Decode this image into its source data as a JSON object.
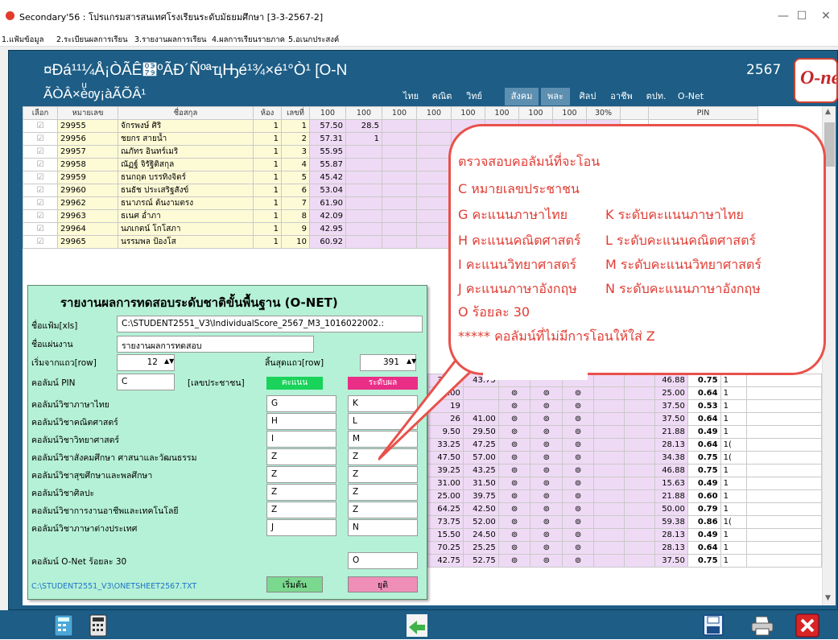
{
  "window": {
    "title": "Secondary'56 : โปรแกรมสารสนเทศโรงเรียนระดับมัธยมศึกษา [3-3-2567-2]",
    "minimize_glyph": "—",
    "maximize_glyph": "☐",
    "close_glyph": "✕"
  },
  "menu": [
    "1.แฟ้มข้อมูล",
    "2.ระเบียนผลการเรียน",
    "3.รายงานผลการเรียน",
    "4.ผลการเรียนรายภาค",
    "5.อเนกประสงค์"
  ],
  "header": {
    "title_line1": "¤Ðá¹¹¼Å¡ÒÃÊ͹ºÃÐ´ÑºªҵԢé¹¾×é¹°Ò¹ [O-N",
    "title_line2": "ÃÒÂ×èͧѹ¡àÃÕÂ¹",
    "year": "2567",
    "logo_text": "O-net",
    "subjects": [
      "ไทย",
      "คณิต",
      "วิทย์",
      "สังคม",
      "พละ",
      "ศิลป",
      "อาชีพ",
      "ตปท.",
      "O-Net"
    ]
  },
  "table": {
    "columns": [
      "เลือก",
      "หมายเลข",
      "ชื่อสกุล",
      "ห้อง",
      "เลขที่",
      "100",
      "100",
      "100",
      "100",
      "100",
      "100",
      "100",
      "100",
      "30%",
      "",
      "PIN"
    ],
    "top_rows": [
      {
        "check": "☑",
        "id": "29955",
        "name": "จักรพงษ์ ศิริ",
        "room": "1",
        "no": "1",
        "s1": "57.50",
        "s2": "28.5"
      },
      {
        "check": "☑",
        "id": "29956",
        "name": "ชยกร สายน้ำ",
        "room": "1",
        "no": "2",
        "s1": "57.31",
        "s2": "1"
      },
      {
        "check": "☑",
        "id": "29957",
        "name": "ณภัทร อินทร์เมริ",
        "room": "1",
        "no": "3",
        "s1": "55.95",
        "s2": ""
      },
      {
        "check": "☑",
        "id": "29958",
        "name": "ณัฏฐ์ จิรัฐิติสกุล",
        "room": "1",
        "no": "4",
        "s1": "55.87",
        "s2": ""
      },
      {
        "check": "☑",
        "id": "29959",
        "name": "ธนกฤต บรรทิงจิตร์",
        "room": "1",
        "no": "5",
        "s1": "45.42",
        "s2": ""
      },
      {
        "check": "☑",
        "id": "29960",
        "name": "ธนธัช ประเสริฐสังข์",
        "room": "1",
        "no": "6",
        "s1": "53.04",
        "s2": ""
      },
      {
        "check": "☑",
        "id": "29962",
        "name": "ธนาภรณ์ ต้นงามตรง",
        "room": "1",
        "no": "7",
        "s1": "61.90",
        "s2": ""
      },
      {
        "check": "☑",
        "id": "29963",
        "name": "ธเนศ อ่ำภา",
        "room": "1",
        "no": "8",
        "s1": "42.09",
        "s2": ""
      },
      {
        "check": "☑",
        "id": "29964",
        "name": "นภเกตน์ โกโสภา",
        "room": "1",
        "no": "9",
        "s1": "42.95",
        "s2": ""
      },
      {
        "check": "☑",
        "id": "29965",
        "name": "นรรมพล ป้องโส",
        "room": "1",
        "no": "10",
        "s1": "60.92",
        "s2": ""
      }
    ],
    "side_rows": [
      {
        "a": "33.25",
        "b": "43.75",
        "c": "",
        "d": "",
        "e": "",
        "pct": "46.88",
        "g": "0.75",
        "t": "1"
      },
      {
        "a": "44.00",
        "b": "",
        "c": "⊚",
        "d": "⊚",
        "e": "⊚",
        "pct": "25.00",
        "g": "0.64",
        "t": "1"
      },
      {
        "a": "19",
        "b": "",
        "c": "⊚",
        "d": "⊚",
        "e": "⊚",
        "pct": "37.50",
        "g": "0.53",
        "t": "1"
      },
      {
        "a": "26",
        "b": "41.00",
        "c": "⊚",
        "d": "⊚",
        "e": "⊚",
        "pct": "37.50",
        "g": "0.64",
        "t": "1"
      },
      {
        "a": "9.50",
        "b": "29.50",
        "c": "⊚",
        "d": "⊚",
        "e": "⊚",
        "pct": "21.88",
        "g": "0.49",
        "t": "1"
      },
      {
        "a": "33.25",
        "b": "47.25",
        "c": "⊚",
        "d": "⊚",
        "e": "⊚",
        "pct": "28.13",
        "g": "0.64",
        "t": "1("
      },
      {
        "a": "47.50",
        "b": "57.00",
        "c": "⊚",
        "d": "⊚",
        "e": "⊚",
        "pct": "34.38",
        "g": "0.75",
        "t": "1("
      },
      {
        "a": "39.25",
        "b": "43.25",
        "c": "⊚",
        "d": "⊚",
        "e": "⊚",
        "pct": "46.88",
        "g": "0.75",
        "t": "1"
      },
      {
        "a": "31.00",
        "b": "31.50",
        "c": "⊚",
        "d": "⊚",
        "e": "⊚",
        "pct": "15.63",
        "g": "0.49",
        "t": "1"
      },
      {
        "a": "25.00",
        "b": "39.75",
        "c": "⊚",
        "d": "⊚",
        "e": "⊚",
        "pct": "21.88",
        "g": "0.60",
        "t": "1"
      },
      {
        "a": "64.25",
        "b": "42.50",
        "c": "⊚",
        "d": "⊚",
        "e": "⊚",
        "pct": "50.00",
        "g": "0.79",
        "t": "1"
      },
      {
        "a": "73.75",
        "b": "52.00",
        "c": "⊚",
        "d": "⊚",
        "e": "⊚",
        "pct": "59.38",
        "g": "0.86",
        "t": "1("
      },
      {
        "a": "15.50",
        "b": "24.50",
        "c": "⊚",
        "d": "⊚",
        "e": "⊚",
        "pct": "28.13",
        "g": "0.49",
        "t": "1"
      },
      {
        "a": "70.25",
        "b": "25.25",
        "c": "⊚",
        "d": "⊚",
        "e": "⊚",
        "pct": "28.13",
        "g": "0.64",
        "t": "1"
      },
      {
        "a": "42.75",
        "b": "52.75",
        "c": "⊚",
        "d": "⊚",
        "e": "⊚",
        "pct": "37.50",
        "g": "0.75",
        "t": "1"
      }
    ]
  },
  "panel": {
    "title": "รายงานผลการทดสอบระดับชาติขั้นพื้นฐาน (O-NET)",
    "file_label": "ชื่อแฟ้ม[xls]",
    "file_value": "C:\\STUDENT2551_V3\\IndividualScore_2567_M3_1016022002.:",
    "sheet_label": "ชื่อแผ่นงาน",
    "sheet_value": "รายงานผลการทดสอบ",
    "start_label": "เริ่มจากแถว[row]",
    "start_value": "12",
    "end_label": "สิ้นสุดแถว[row]",
    "end_value": "391",
    "pin_label": "คอลัมน์ PIN",
    "pin_value": "C",
    "pin_hint": "[เลขประชาชน]",
    "score_badge": "คะแนน",
    "grade_badge": "ระดับผล",
    "subjects": [
      {
        "label": "คอลัมน์วิชาภาษาไทย",
        "score": "G",
        "grade": "K"
      },
      {
        "label": "คอลัมน์วิชาคณิตศาสตร์",
        "score": "H",
        "grade": "L"
      },
      {
        "label": "คอลัมน์วิชาวิทยาศาสตร์",
        "score": "I",
        "grade": "M"
      },
      {
        "label": "คอลัมน์วิชาสังคมศึกษา ศาสนาและวัฒนธรรม",
        "score": "Z",
        "grade": "Z"
      },
      {
        "label": "คอลัมน์วิชาสุขศึกษาและพลศึกษา",
        "score": "Z",
        "grade": "Z"
      },
      {
        "label": "คอลัมน์วิชาศิลปะ",
        "score": "Z",
        "grade": "Z"
      },
      {
        "label": "คอลัมน์วิชาการงานอาชีพและเทคโนโลยี",
        "score": "Z",
        "grade": "Z"
      },
      {
        "label": "คอลัมน์วิชาภาษาต่างประเทศ",
        "score": "J",
        "grade": "N"
      }
    ],
    "onet_label": "คอลัมน์ O-Net ร้อยละ 30",
    "onet_value": "O",
    "output_path": "C:\\STUDENT2551_V3\\ONETSHEET2567.TXT",
    "start_button": "เริ่มต้น",
    "stop_button": "ยุติ",
    "colors": {
      "score_badge": "#19d35a",
      "grade_badge": "#ea2d86",
      "start_button": "#7bd88f",
      "stop_button": "#ef8fb7"
    }
  },
  "bubble": {
    "title": "ตรวจสอบคอลัมน์ที่จะโอน",
    "lines": [
      "C หมายเลขประชาชน",
      "G คะแนนภาษาไทย",
      "K ระดับคะแนนภาษาไทย",
      "H คะแนนคณิตศาสตร์",
      "L ระดับคะแนนคณิตศาสตร์",
      "I คะแนนวิทยาศาสตร์",
      "M ระดับคะแนนวิทยาศาสตร์",
      "J คะแนนภาษาอังกฤษ",
      "N ระดับคะแนนภาษาอังกฤษ",
      "O ร้อยละ 30",
      "***** คอลัมน์ที่ไม่มีการโอนให้ใส่ Z"
    ],
    "color": "#e03c33"
  },
  "toolbar": {
    "icons": [
      "calculator-icon",
      "calculator-dark-icon",
      "back-arrow-icon",
      "save-icon",
      "print-icon",
      "close-icon"
    ]
  }
}
